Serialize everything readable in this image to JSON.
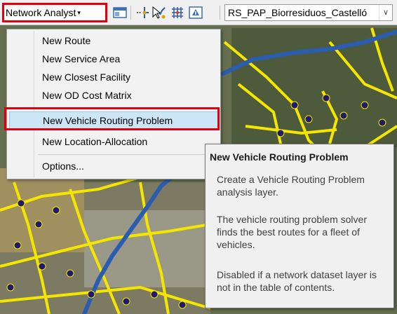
{
  "toolbar": {
    "network_analyst_label": "Network Analyst",
    "dropdown_caret": "▾",
    "layer_select_value": "RS_PAP_Biorresiduos_Castelló",
    "layer_select_caret": "∨",
    "icons": [
      "network-analyst-window-icon",
      "create-network-location-icon",
      "select-move-location-icon",
      "build-network-icon",
      "solve-icon"
    ]
  },
  "menu": {
    "items": [
      {
        "label": "New Route"
      },
      {
        "label": "New Service Area"
      },
      {
        "label": "New Closest Facility"
      },
      {
        "label": "New OD Cost Matrix"
      },
      {
        "label": "New Vehicle Routing Problem",
        "selected": true
      },
      {
        "label": "New Location-Allocation"
      },
      {
        "label": "Options..."
      }
    ]
  },
  "tooltip": {
    "title": "New Vehicle Routing Problem",
    "paragraphs": [
      "Create a Vehicle Routing Problem analysis layer.",
      "The vehicle routing problem solver finds the best routes for a fleet of vehicles.",
      "Disabled if a network dataset layer is not in the table of contents."
    ]
  },
  "colors": {
    "highlight_border": "#e0000f",
    "menu_selected": "#cde6f7",
    "road_yellow": "#f5e600",
    "route_blue": "#2a5db0",
    "point_navy": "#1f1a6e"
  }
}
